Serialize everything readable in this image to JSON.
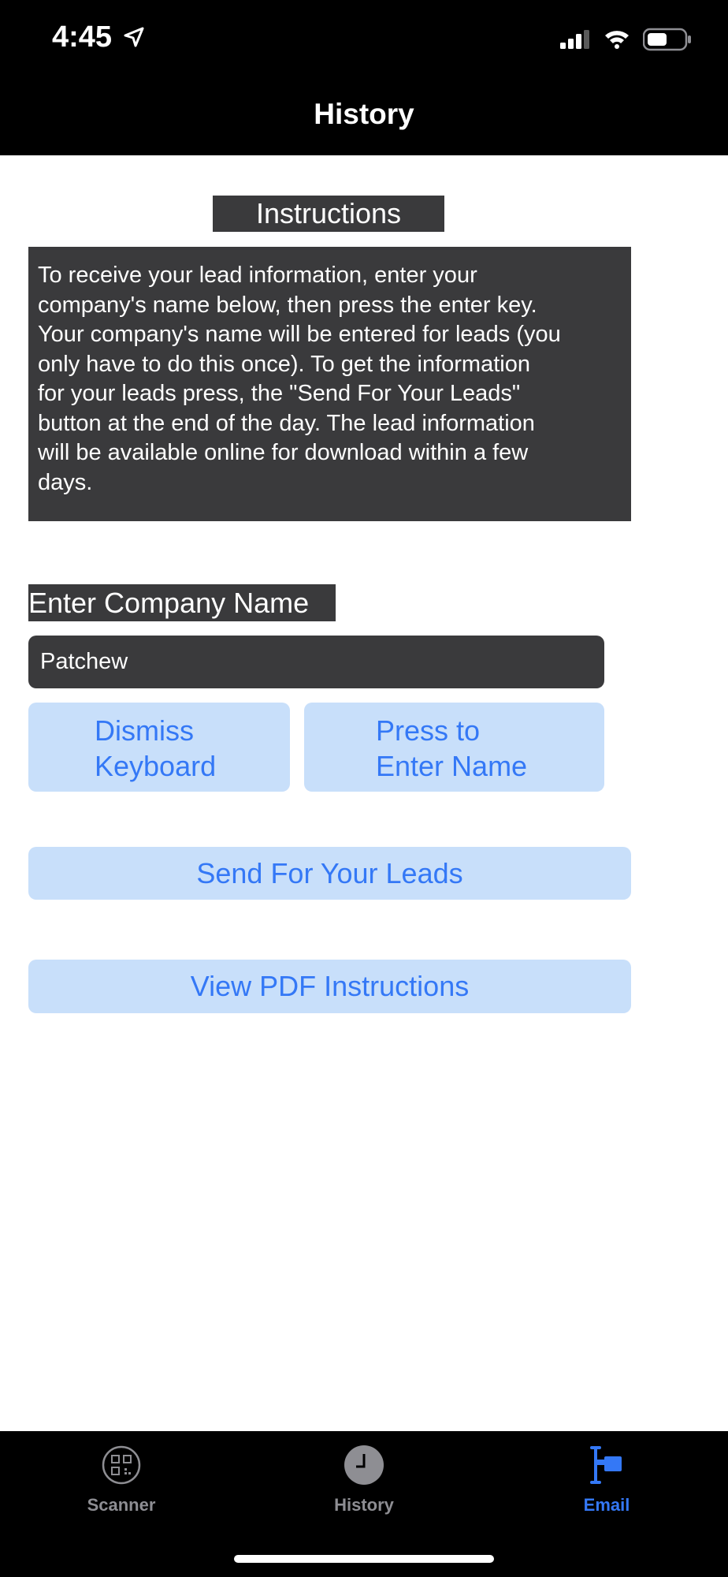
{
  "status_bar": {
    "time": "4:45",
    "icons": [
      "location-arrow-icon",
      "cellular-signal-icon",
      "wifi-icon",
      "battery-icon"
    ]
  },
  "nav": {
    "title": "History"
  },
  "instructions": {
    "heading": "Instructions",
    "text": "To receive your lead information, enter your\ncompany's name below, then press the enter key.\nYour company's name will be entered for leads (you\nonly have to do this once). To get the information\nfor your leads press, the \"Send For Your Leads\"\nbutton at the end of the day. The lead information\nwill be available online for download within a few\ndays."
  },
  "company": {
    "label": "Enter Company Name",
    "value": "Patchew"
  },
  "buttons": {
    "dismiss": [
      "Dismiss",
      "Keyboard"
    ],
    "enter": [
      "Press to",
      "Enter Name"
    ],
    "send": "Send For Your Leads",
    "pdf": "View PDF Instructions"
  },
  "tab_bar": {
    "items": [
      {
        "label": "Scanner",
        "icon": "qr-scanner-icon",
        "selected": false
      },
      {
        "label": "History",
        "icon": "clock-icon",
        "selected": false
      },
      {
        "label": "Email",
        "icon": "email-flag-icon",
        "selected": true
      }
    ]
  },
  "colors": {
    "accent": "#3478f6",
    "button_bg": "#c8dffa",
    "dark_box": "#3a3a3c",
    "inactive_tab": "#8e8e93"
  }
}
